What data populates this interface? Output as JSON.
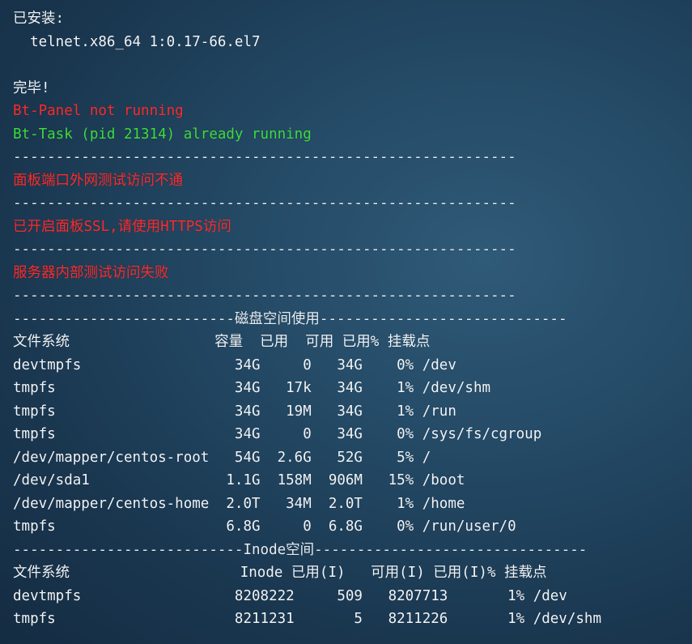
{
  "terminal": {
    "lines": [
      {
        "text": "已安装:",
        "color": "default"
      },
      {
        "text": "  telnet.x86_64 1:0.17-66.el7",
        "color": "default"
      },
      {
        "text": "",
        "color": "default"
      },
      {
        "text": "完毕!",
        "color": "default"
      },
      {
        "text": "Bt-Panel not running",
        "color": "red"
      },
      {
        "text": "Bt-Task (pid 21314) already running",
        "color": "green"
      },
      {
        "text": "-----------------------------------------------------------",
        "color": "sep"
      },
      {
        "text": "面板端口外网测试访问不通",
        "color": "red"
      },
      {
        "text": "-----------------------------------------------------------",
        "color": "sep"
      },
      {
        "text": "已开启面板SSL,请使用HTTPS访问",
        "color": "red"
      },
      {
        "text": "-----------------------------------------------------------",
        "color": "sep"
      },
      {
        "text": "服务器内部测试访问失败",
        "color": "red"
      },
      {
        "text": "-----------------------------------------------------------",
        "color": "sep"
      },
      {
        "text": "--------------------------磁盘空间使用-----------------------------",
        "color": "sep"
      },
      {
        "text": "文件系统                 容量  已用  可用 已用% 挂载点",
        "color": "default"
      },
      {
        "text": "devtmpfs                  34G     0   34G    0% /dev",
        "color": "default"
      },
      {
        "text": "tmpfs                     34G   17k   34G    1% /dev/shm",
        "color": "default"
      },
      {
        "text": "tmpfs                     34G   19M   34G    1% /run",
        "color": "default"
      },
      {
        "text": "tmpfs                     34G     0   34G    0% /sys/fs/cgroup",
        "color": "default"
      },
      {
        "text": "/dev/mapper/centos-root   54G  2.6G   52G    5% /",
        "color": "default"
      },
      {
        "text": "/dev/sda1                1.1G  158M  906M   15% /boot",
        "color": "default"
      },
      {
        "text": "/dev/mapper/centos-home  2.0T   34M  2.0T    1% /home",
        "color": "default"
      },
      {
        "text": "tmpfs                    6.8G     0  6.8G    0% /run/user/0",
        "color": "default"
      },
      {
        "text": "---------------------------Inode空间--------------------------------",
        "color": "sep"
      },
      {
        "text": "文件系统                    Inode 已用(I)   可用(I) 已用(I)% 挂载点",
        "color": "default"
      },
      {
        "text": "devtmpfs                  8208222     509   8207713       1% /dev",
        "color": "default"
      },
      {
        "text": "tmpfs                     8211231       5   8211226       1% /dev/shm",
        "color": "default"
      }
    ]
  }
}
